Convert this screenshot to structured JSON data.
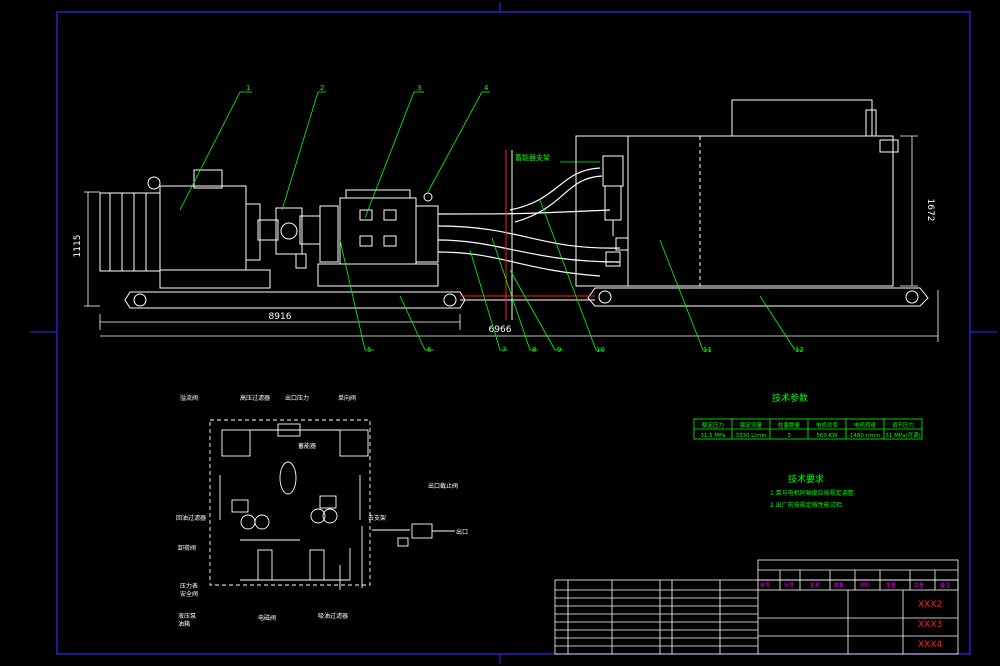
{
  "balloons": [
    "1",
    "2",
    "3",
    "4",
    "5",
    "6",
    "7",
    "8",
    "9",
    "10",
    "11",
    "12"
  ],
  "dimensions": {
    "height_1115": "1115",
    "length_8916": "8916",
    "length_6966": "6966",
    "height_1672": "1672"
  },
  "main_view": {
    "accumulator_label": "蓄能器支架"
  },
  "tech_params": {
    "title": "技术参数",
    "headers": [
      "额定压力",
      "额定流量",
      "柱塞数量",
      "电机功率",
      "电机转速",
      "调节压力"
    ],
    "values": [
      "31.5 MPa",
      "3330 L/min",
      "3",
      "560 KW",
      "1480 r/min",
      "31 MPa(可调)"
    ]
  },
  "tech_req": {
    "title": "技术要求",
    "items": [
      "1.泵与电机同轴度应按规定调整.",
      "2.出厂前按规定做性能试验."
    ]
  },
  "schematic_labels": {
    "relief_valve": "溢流阀",
    "high_pressure_filter": "高压过滤器",
    "working_pressure": "出口压力",
    "check_valve": "单向阀",
    "accumulator": "蓄能器",
    "return_filter": "回油过滤器",
    "unloading_valve": "卸荷阀",
    "pressure_gauge": "压力表",
    "safety_valve": "安全阀",
    "hydraulic_pump": "液压泵",
    "oil_tank": "油箱",
    "solenoid_valve": "电磁阀",
    "suction_filter": "吸油过滤器",
    "outlet_valve": "出口截止阀",
    "to_support": "去支架",
    "outlet": "出口"
  },
  "title_block": {
    "tag_xxx2": "XXX2",
    "tag_xxx3": "XXX3",
    "tag_xxx4": "XXX4",
    "header_row": [
      "序号",
      "代号",
      "名称",
      "数量",
      "材料",
      "单重",
      "总重",
      "备注"
    ]
  },
  "colors": {
    "frame": "#2a2aff",
    "geometry": "#ffffff",
    "leader": "#00ff00",
    "text": "#00ff00",
    "dim": "#ffffff",
    "red": "#ff2020",
    "magenta": "#ff00ff",
    "cyan": "#00c8ff"
  }
}
